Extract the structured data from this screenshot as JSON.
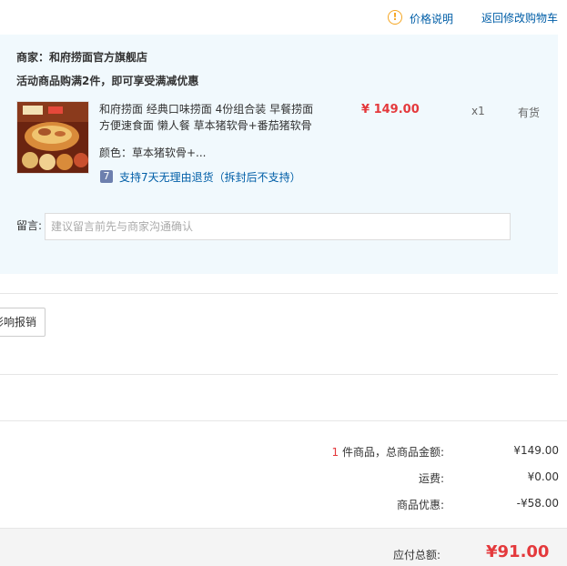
{
  "header": {
    "price_explain": "价格说明",
    "back_to_cart": "返回修改购物车"
  },
  "shop": {
    "merchant": "商家：和府捞面官方旗舰店",
    "promo": "活动商品购满2件，即可享受满减优惠"
  },
  "item": {
    "name_line1": "和府捞面 经典口味捞面 4份组合装 早餐捞面",
    "name_line2": "方便速食面 懒人餐 草本猪软骨+番茄猪软骨",
    "price": "¥ 149.00",
    "qty": "x1",
    "stock": "有货",
    "color": "颜色：草本猪软骨+...",
    "return_badge": "7",
    "return_policy": "支持7天无理由退货（拆封后不支持）"
  },
  "message": {
    "label": "留言:",
    "placeholder": "建议留言前先与商家沟通确认"
  },
  "invoice_button_label": "影响报销",
  "summary": {
    "count": "1",
    "count_label": " 件商品，总商品金额:",
    "goods_total": "¥149.00",
    "shipping_label": "运费:",
    "shipping": "¥0.00",
    "discount_label": "商品优惠:",
    "discount": "-¥58.00",
    "payable_label": "应付总额:",
    "payable": "¥91.00"
  },
  "colors": {
    "accent_red": "#e4393c",
    "link_blue": "#005ea7",
    "panel_bg": "#f1f9fd",
    "warn_orange": "#f5a623"
  }
}
